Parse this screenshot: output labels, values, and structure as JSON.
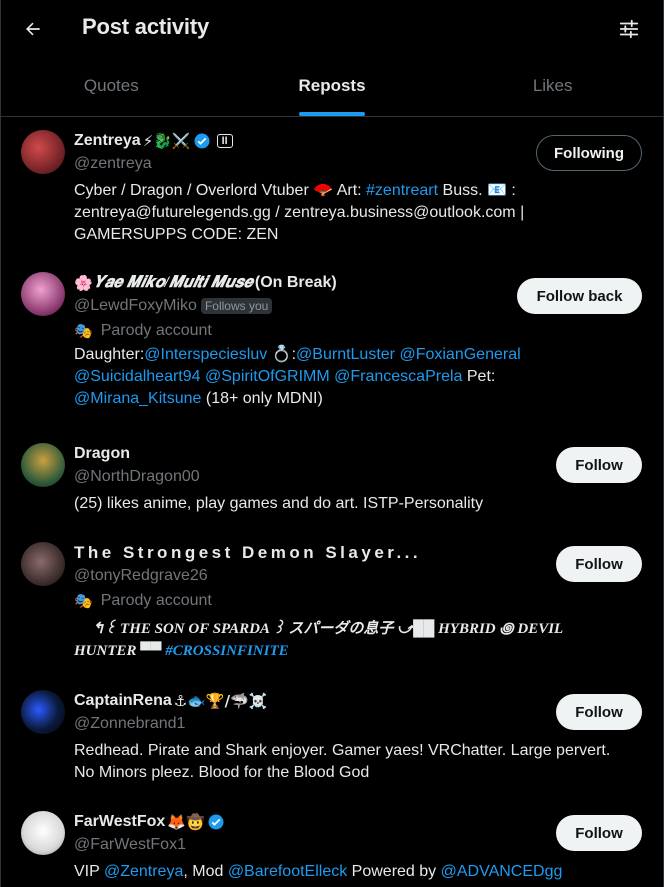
{
  "header": {
    "title": "Post activity"
  },
  "tabs": [
    {
      "label": "Quotes"
    },
    {
      "label": "Reposts"
    },
    {
      "label": "Likes"
    }
  ],
  "users": [
    {
      "name": "Zentreya",
      "name_emoji": "⚡🐉⚔️",
      "handle": "@zentreya",
      "button": "Following",
      "bio": {
        "l1_a": "Cyber / Dragon / Overlord Vtuber 🪭 Art: ",
        "l1_link": "#zentreart",
        "l1_b": " Buss. 📧 :",
        "l2": "zentreya@futurelegends.gg / zentreya.business@outlook.com |",
        "l3": "GAMERSUPPS CODE: ZEN"
      },
      "avatar_color": "#6b1f24"
    },
    {
      "name_prefix": "🌸",
      "name": "𝒀𝒂𝒆 𝑴𝒊𝒌𝒐/𝑴𝒖𝒍𝒕𝒊 𝑴𝒖𝒔𝒆",
      "name_suffix": " (On Break)",
      "handle": "@LewdFoxyMiko",
      "follows_you": "Follows you",
      "parody": "Parody account",
      "button": "Follow back",
      "bio": {
        "l1_a": "Daughter:",
        "l1_link1": "@Interspeciesluv",
        "l1_b": " 💍:",
        "l1_link2": "@BurntLuster",
        "l1_link3": "@FoxianGeneral",
        "l2_link1": "@Suicidalheart94",
        "l2_link2": "@SpiritOfGRIMM",
        "l2_link3": "@FrancescaPrela",
        "l2_b": " Pet:",
        "l3_link": "@Mirana_Kitsune",
        "l3_b": " (18+ only MDNI)"
      },
      "avatar_color": "#8a3a6e"
    },
    {
      "name": "Dragon",
      "handle": "@NorthDragon00",
      "button": "Follow",
      "bio": {
        "l1": "(25) likes anime, play games and do art. ISTP-Personality"
      },
      "avatar_color": "#2f5a3a"
    },
    {
      "name": "The Strongest Demon Slayer...",
      "handle": "@tonyRedgrave26",
      "parody": "Parody account",
      "button": "Follow",
      "bio": {
        "l1": "↰꒰ THE SON OF SPARDA ꒱ スパーダの息子 ⤻██ HYBRID ꩜ DEVIL",
        "l2_a": "HUNTER ▀▀ ",
        "l2_link": "#CROSSINFINITE"
      },
      "avatar_color": "#3a2b2b"
    },
    {
      "name": "CaptainRena",
      "name_emoji": "⚓🐟🏆/🦈☠️",
      "handle": "@Zonnebrand1",
      "button": "Follow",
      "bio": {
        "l1": "Redhead. Pirate and Shark enjoyer. Gamer yaes! VRChatter. Large pervert.",
        "l2": "No Minors pleez. Blood for the Blood God"
      },
      "avatar_color": "#0b1a3a"
    },
    {
      "name": "FarWestFox",
      "name_emoji": "🦊🤠",
      "handle": "@FarWestFox1",
      "button": "Follow",
      "bio": {
        "l1_a": "VIP ",
        "l1_link1": "@Zentreya",
        "l1_b": ", Mod ",
        "l1_link2": "@BarefootElleck",
        "l1_c": " Powered by ",
        "l1_link3": "@ADVANCEDgg"
      },
      "avatar_color": "#d9d9d9"
    }
  ],
  "colors": {
    "accent": "#1d9bf0",
    "muted": "#71767b",
    "bg": "#000000"
  }
}
